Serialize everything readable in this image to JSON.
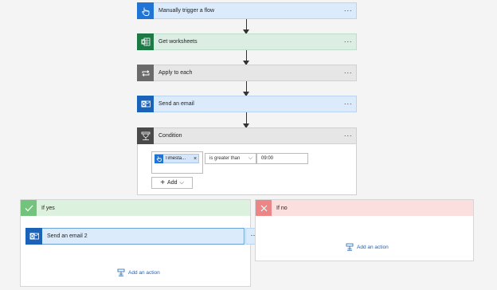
{
  "steps": [
    {
      "label": "Manually trigger a flow",
      "icon": "touch-icon",
      "color": "#1f74d6"
    },
    {
      "label": "Get worksheets",
      "icon": "excel-icon",
      "color": "#1d7a45"
    },
    {
      "label": "Apply to each",
      "icon": "loop-icon",
      "color": "#6b6b6b"
    },
    {
      "label": "Send an email",
      "icon": "outlook-icon",
      "color": "#1a63b8"
    },
    {
      "label": "Condition",
      "icon": "condition-icon",
      "color": "#4a4a4a"
    }
  ],
  "more_label": "···",
  "condition": {
    "token_label": "Timesta...",
    "token_remove": "×",
    "operator": "is greater than",
    "value": "09:00",
    "add_label": "Add"
  },
  "branches": {
    "yes": {
      "label": "If yes",
      "action_label": "Send an email 2",
      "add_action": "Add an action"
    },
    "no": {
      "label": "If no",
      "add_action": "Add an action"
    }
  },
  "colors": {
    "yes_accent": "#72c47c",
    "no_accent": "#ec8686",
    "link": "#2161b3"
  }
}
